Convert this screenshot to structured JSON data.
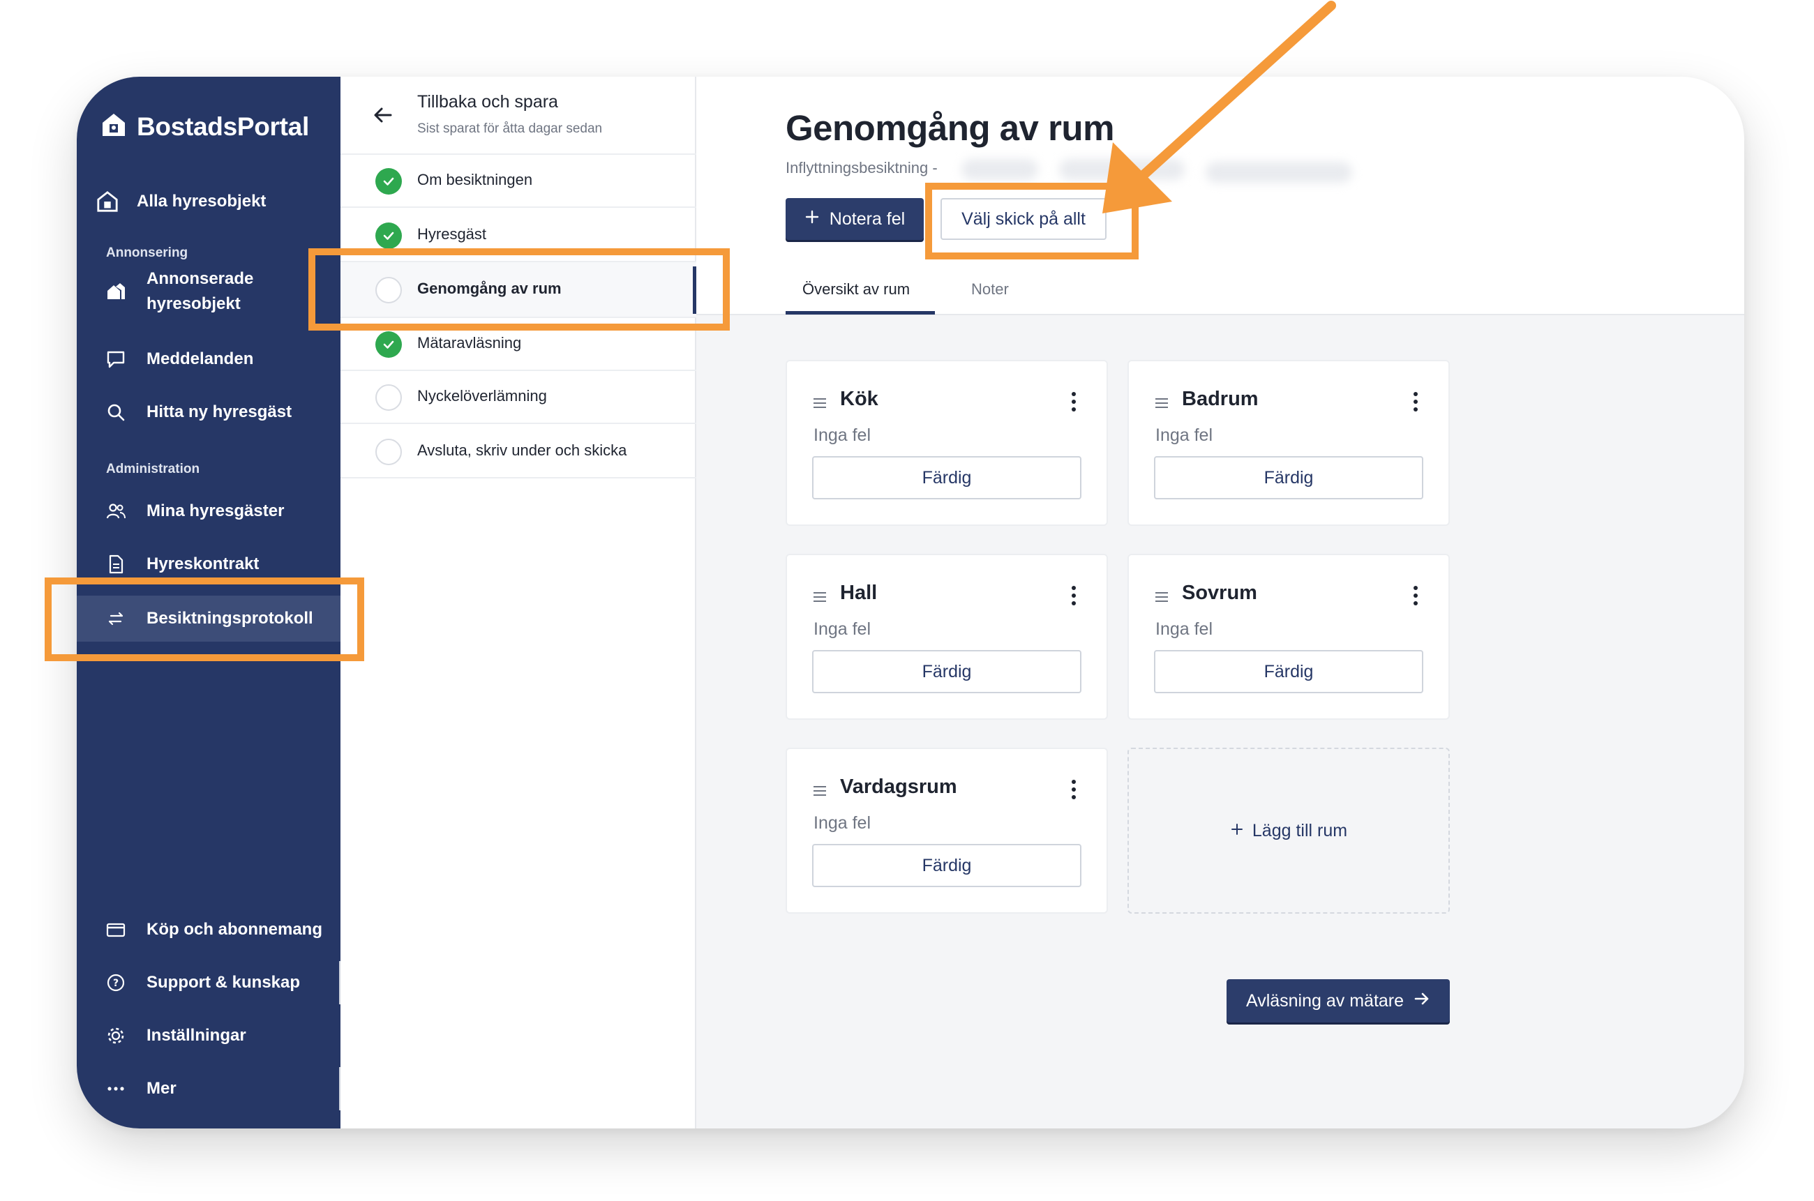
{
  "app": {
    "name": "BostadsPortal"
  },
  "colors": {
    "sidebar": "#263766",
    "accent": "#2c3d6b",
    "success": "#2ea84f",
    "highlight": "#f59a3a"
  },
  "sidebar": {
    "all_objects": "Alla hyresobjekt",
    "section_ads": "Annonsering",
    "advertised_line1": "Annonserade",
    "advertised_line2": "hyresobjekt",
    "messages": "Meddelanden",
    "find_tenant": "Hitta ny hyresgäst",
    "section_admin": "Administration",
    "my_tenants": "Mina hyresgäster",
    "leases": "Hyreskontrakt",
    "inspection": "Besiktningsprotokoll",
    "purchases": "Köp och abonnemang",
    "support": "Support & kunskap",
    "settings": "Inställningar",
    "more": "Mer"
  },
  "steps_panel": {
    "back_title": "Tillbaka och spara",
    "back_sub": "Sist sparat för åtta dagar sedan",
    "steps": [
      {
        "label": "Om besiktningen",
        "done": true
      },
      {
        "label": "Hyresgäst",
        "done": true
      },
      {
        "label": "Genomgång av rum",
        "done": false,
        "current": true
      },
      {
        "label": "Mätaravläsning",
        "done": true
      },
      {
        "label": "Nyckelöverlämning",
        "done": false
      },
      {
        "label": "Avsluta, skriv under och skicka",
        "done": false
      }
    ]
  },
  "main": {
    "title": "Genomgång av rum",
    "subtitle": "Inflyttningsbesiktning -",
    "note_button": "Notera fel",
    "select_all_button": "Välj skick på allt",
    "tabs": [
      "Översikt av rum",
      "Noter"
    ],
    "rooms": [
      {
        "name": "Kök",
        "status": "Inga fel",
        "button": "Färdig"
      },
      {
        "name": "Badrum",
        "status": "Inga fel",
        "button": "Färdig"
      },
      {
        "name": "Hall",
        "status": "Inga fel",
        "button": "Färdig"
      },
      {
        "name": "Sovrum",
        "status": "Inga fel",
        "button": "Färdig"
      },
      {
        "name": "Vardagsrum",
        "status": "Inga fel",
        "button": "Färdig"
      }
    ],
    "add_room": "Lägg till rum",
    "next_button": "Avläsning av mätare"
  }
}
